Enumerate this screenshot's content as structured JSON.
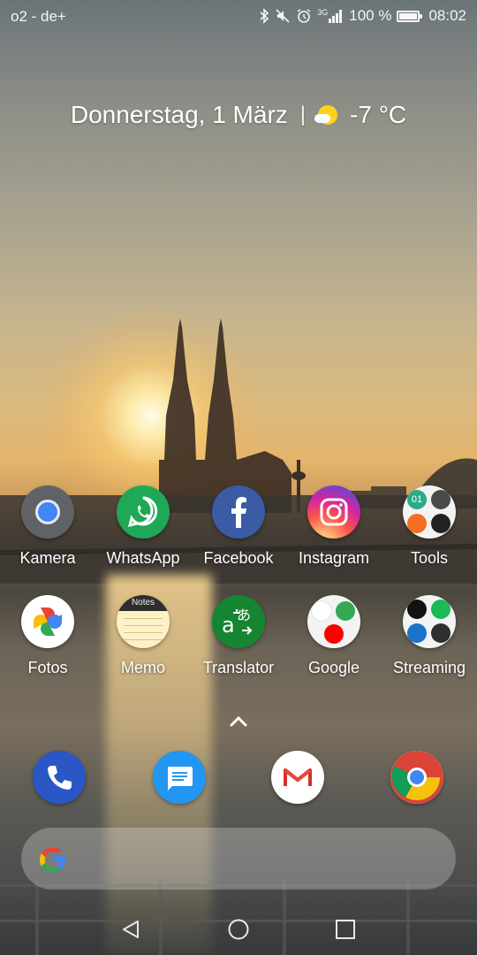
{
  "status_bar": {
    "carrier": "o2 - de+",
    "network": "3G",
    "battery_text": "100 %",
    "time": "08:02",
    "icons": [
      "bluetooth-icon",
      "mute-icon",
      "alarm-icon",
      "signal-icon",
      "battery-icon"
    ]
  },
  "widget": {
    "date": "Donnerstag, 1 März",
    "separator": "|",
    "temperature": "-7 °C",
    "weather_icon": "partly-sunny-icon"
  },
  "apps_row1": [
    {
      "label": "Kamera",
      "icon": "camera-icon"
    },
    {
      "label": "WhatsApp",
      "icon": "whatsapp-icon"
    },
    {
      "label": "Facebook",
      "icon": "facebook-icon"
    },
    {
      "label": "Instagram",
      "icon": "instagram-icon"
    },
    {
      "label": "Tools",
      "icon": "folder-icon"
    }
  ],
  "apps_row2": [
    {
      "label": "Fotos",
      "icon": "google-photos-icon"
    },
    {
      "label": "Memo",
      "icon": "notes-icon",
      "icon_text": "Notes"
    },
    {
      "label": "Translator",
      "icon": "translate-icon"
    },
    {
      "label": "Google",
      "icon": "folder-icon"
    },
    {
      "label": "Streaming",
      "icon": "folder-icon"
    }
  ],
  "tools_folder_text": "01",
  "dock": [
    "phone-icon",
    "messages-icon",
    "gmail-icon",
    "chrome-icon"
  ],
  "search_bar": {
    "icon": "google-g-icon"
  },
  "nav": [
    "back-icon",
    "home-icon",
    "recents-icon"
  ],
  "colors": {
    "whatsapp": "#1fa855",
    "facebook": "#3b5ca4",
    "translator": "#158532",
    "phone": "#2a56c6",
    "messages": "#2196f3"
  }
}
